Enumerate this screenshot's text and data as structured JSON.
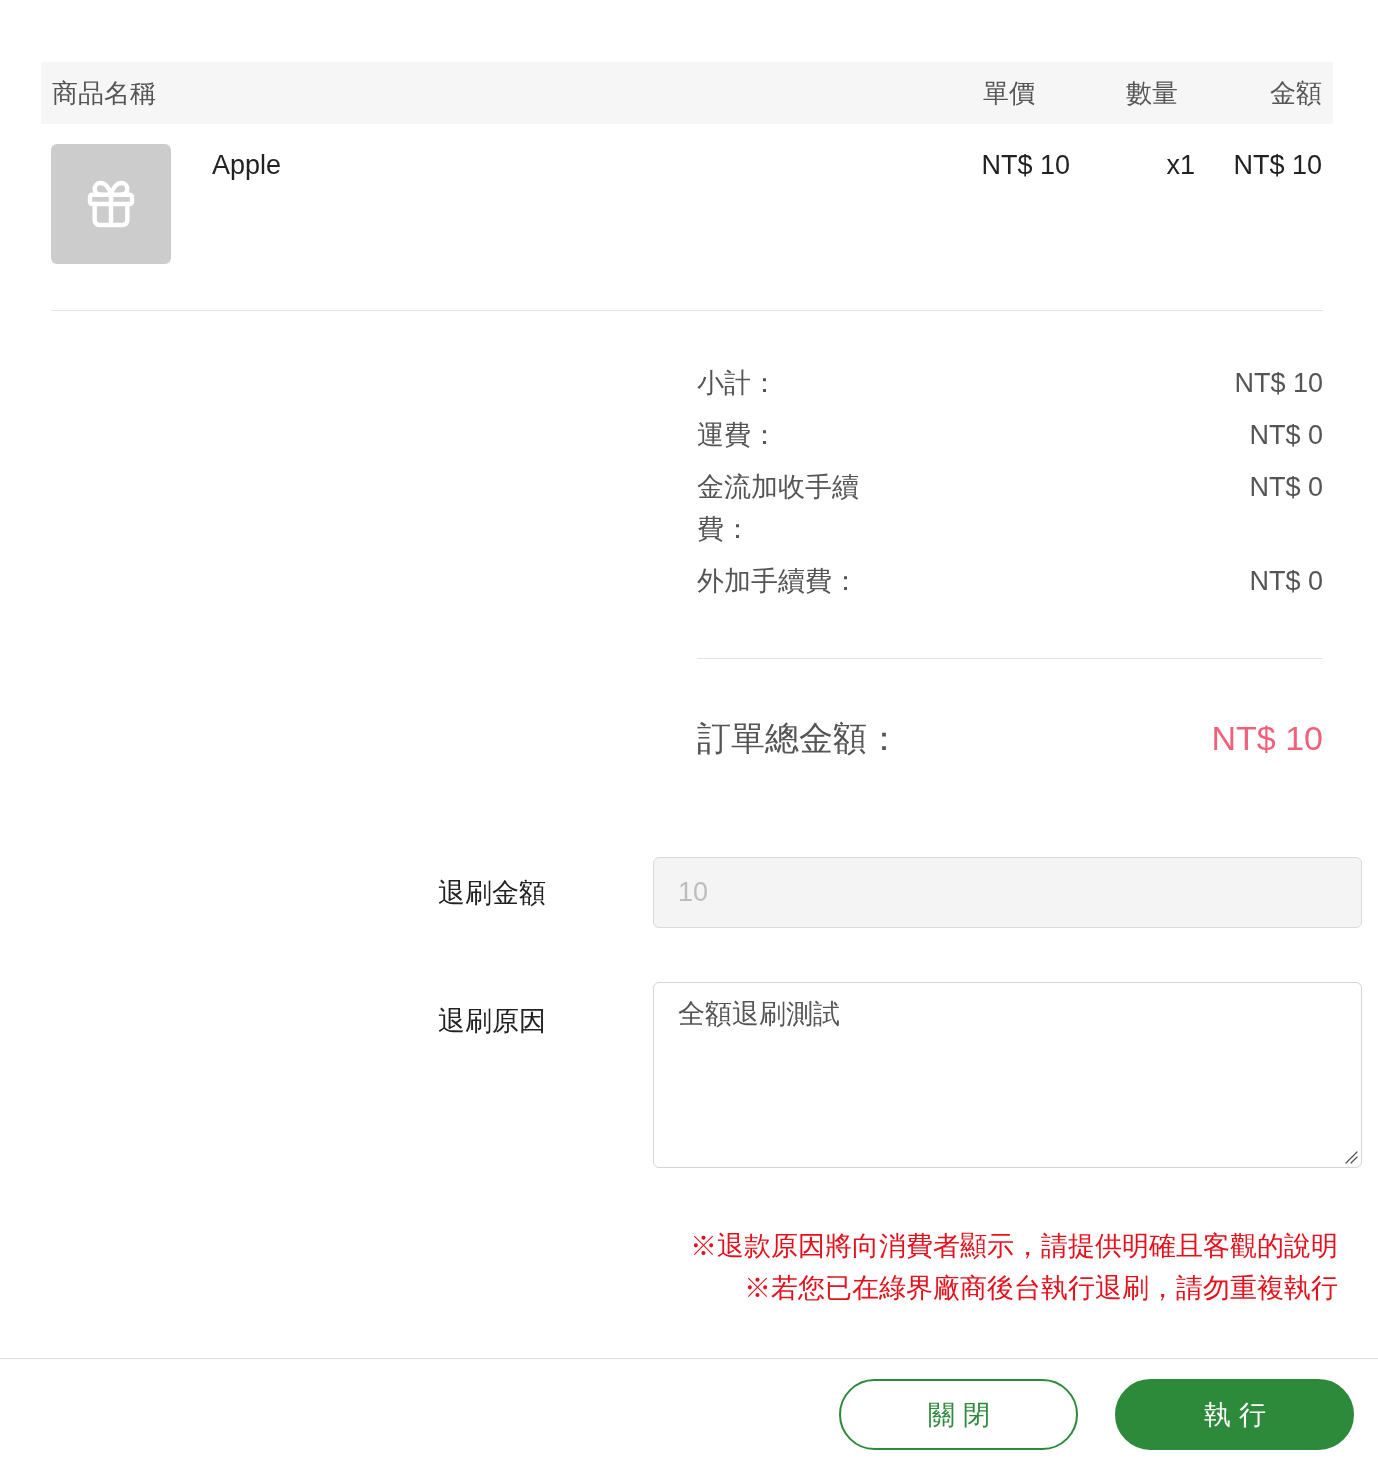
{
  "table": {
    "columns": [
      "商品名稱",
      "單價",
      "數量",
      "金額"
    ],
    "rows": [
      {
        "name": "Apple",
        "unit_price": "NT$ 10",
        "quantity": "x1",
        "amount": "NT$ 10"
      }
    ]
  },
  "summary": {
    "lines": [
      {
        "label": "小計：",
        "value": "NT$ 10"
      },
      {
        "label": "運費：",
        "value": "NT$ 0"
      },
      {
        "label": "金流加收手續費：",
        "value": "NT$ 0"
      },
      {
        "label": "外加手續費：",
        "value": "NT$ 0"
      }
    ],
    "total": {
      "label": "訂單總金額：",
      "value": "NT$ 10"
    }
  },
  "refund_form": {
    "amount": {
      "label": "退刷金額",
      "value": "10",
      "disabled": true
    },
    "reason": {
      "label": "退刷原因",
      "value": "全額退刷測試"
    }
  },
  "notes": [
    "※退款原因將向消費者顯示，請提供明確且客觀的說明",
    "※若您已在綠界廠商後台執行退刷，請勿重複執行"
  ],
  "buttons": [
    {
      "label": "關閉",
      "kind": "outline"
    },
    {
      "label": "執行",
      "kind": "primary"
    }
  ]
}
